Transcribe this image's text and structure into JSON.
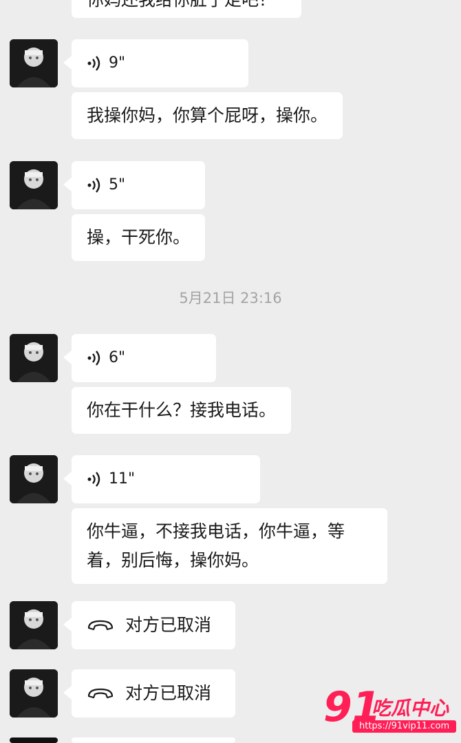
{
  "chat": {
    "top_partial_text": "你妈还我给你脏了走吧？",
    "messages": [
      {
        "type": "voice",
        "duration": "9\""
      },
      {
        "type": "text",
        "text": "我操你妈，你算个屁呀，操你。"
      },
      {
        "type": "voice",
        "duration": "5\""
      },
      {
        "type": "text",
        "text": "操，干死你。"
      },
      {
        "type": "timestamp",
        "text": "5月21日 23:16"
      },
      {
        "type": "voice",
        "duration": "6\""
      },
      {
        "type": "text",
        "text": "你在干什么？接我电话。"
      },
      {
        "type": "voice",
        "duration": "11\""
      },
      {
        "type": "text",
        "line1": "你牛逼，不接我电话，你牛逼，等",
        "line2": "着，别后悔，操你妈。"
      },
      {
        "type": "call",
        "text": "对方已取消"
      },
      {
        "type": "call",
        "text": "对方已取消"
      }
    ]
  },
  "watermark": {
    "number": "91",
    "title": "吃瓜中心",
    "url": "https://91vip11.com",
    "color": "#ff1e55"
  },
  "icons": {
    "voice": "voice-wave-icon",
    "call": "phone-hangup-icon"
  }
}
